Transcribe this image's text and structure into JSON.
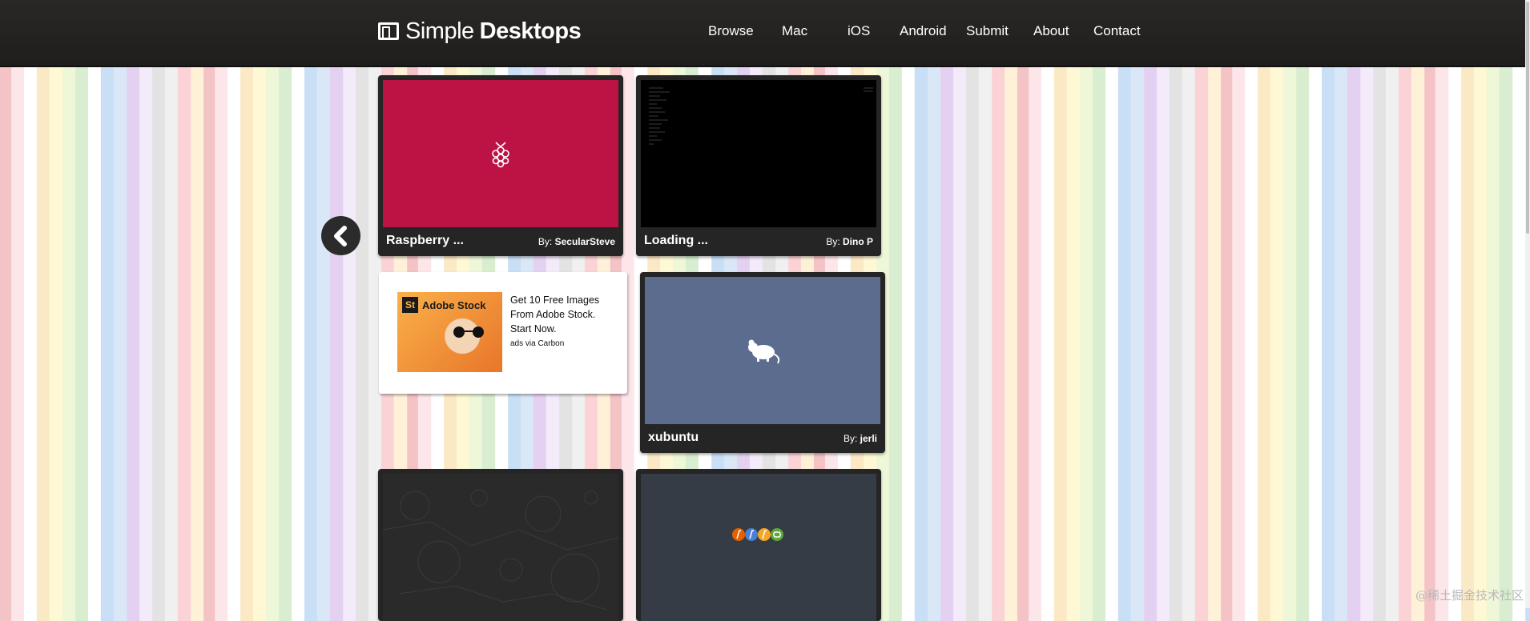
{
  "header": {
    "logo_simple": "Simple",
    "logo_desktops": "Desktops",
    "nav": [
      "Browse",
      "Mac",
      "iOS",
      "Android",
      "Submit",
      "About",
      "Contact"
    ]
  },
  "cards": [
    {
      "title": "Raspberry ...",
      "by": "By:",
      "author": "SecularSteve",
      "color": "#bd1244",
      "icon": "raspberry-icon"
    },
    {
      "title": "Loading ...",
      "by": "By:",
      "author": "Dino P",
      "color": "#000000",
      "icon": "terminal-text"
    },
    {
      "title": "xubuntu",
      "by": "By:",
      "author": "jerli",
      "color": "#5c6c8e",
      "icon": "mouse-icon"
    },
    {
      "title": "",
      "by": "",
      "author": "",
      "color": "#2a2a2a",
      "icon": "astro-map-pattern"
    },
    {
      "title": "",
      "by": "",
      "author": "",
      "color": "#363c45",
      "icon": "browser-logos"
    }
  ],
  "ad": {
    "brand_badge": "St",
    "brand_name": "Adobe Stock",
    "text": "Get 10 Free Images From Adobe Stock. Start Now.",
    "via": "ads via Carbon"
  },
  "watermark": "@稀土掘金技术社区"
}
